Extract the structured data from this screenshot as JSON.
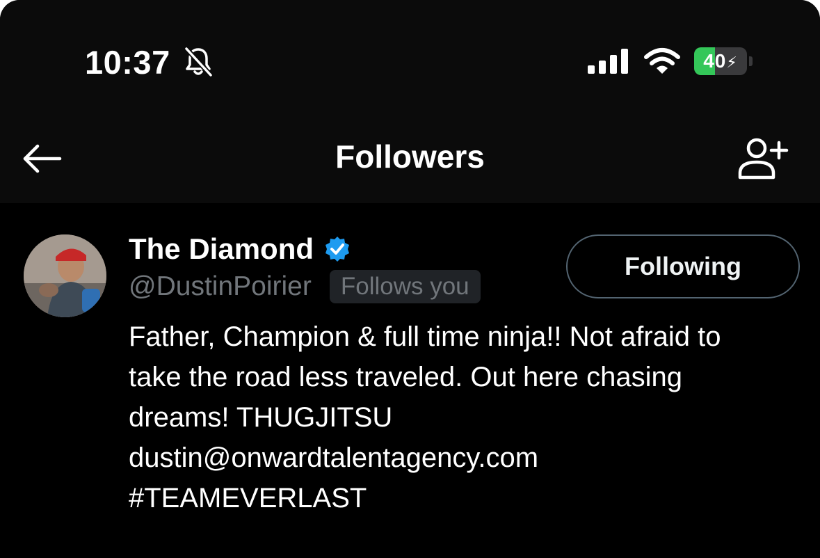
{
  "status_bar": {
    "time": "10:37",
    "battery_percent": "40",
    "battery_level": 0.4,
    "icons": [
      "bell-slash-icon",
      "signal-icon",
      "wifi-icon",
      "battery-charging-icon"
    ]
  },
  "nav": {
    "title": "Followers",
    "back_icon": "arrow-left-icon",
    "add_icon": "add-user-icon"
  },
  "follower": {
    "display_name": "The Diamond",
    "verified": true,
    "verified_color": "#1d9bf0",
    "handle": "@DustinPoirier",
    "follows_badge": "Follows you",
    "follow_button_label": "Following",
    "bio_lines": [
      "Father, Champion & full time ninja!! Not afraid to",
      "take the road less traveled. Out here chasing",
      "dreams! THUGJITSU",
      "dustin@onwardtalentagency.com",
      "#TEAMEVERLAST"
    ]
  },
  "colors": {
    "background": "#000000",
    "header": "#0b0b0b",
    "secondary_text": "#71767b",
    "badge_bg": "#202327",
    "battery_green": "#34c759"
  }
}
